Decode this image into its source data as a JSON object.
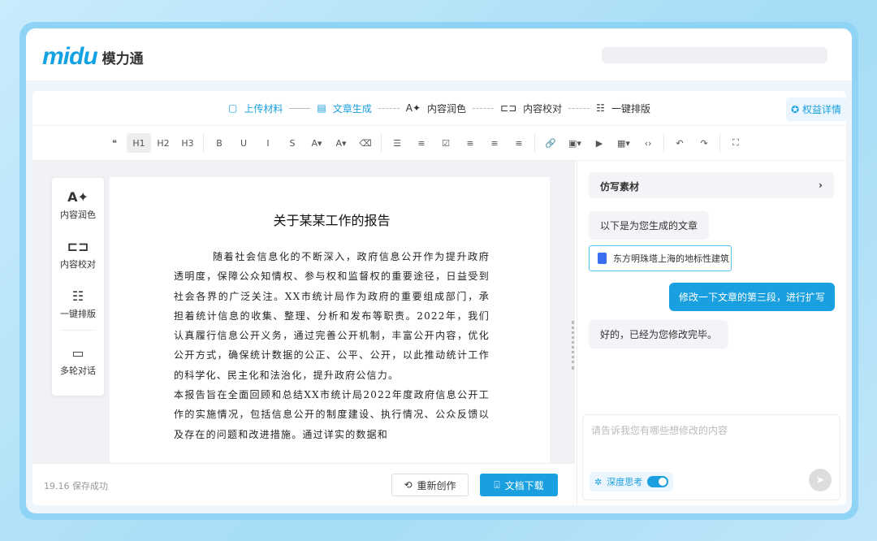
{
  "brand": {
    "logo_text": "midu",
    "name": "模力通"
  },
  "steps": [
    {
      "label": "上传材料",
      "icon": "folder-icon"
    },
    {
      "label": "文章生成",
      "icon": "document-icon"
    },
    {
      "label": "内容润色",
      "icon": "font-sparkle-icon"
    },
    {
      "label": "内容校对",
      "icon": "proofread-icon"
    },
    {
      "label": "一键排版",
      "icon": "layout-icon"
    }
  ],
  "rights_label": "权益详情",
  "toolbar": [
    "❝",
    "H1",
    "H2",
    "H3",
    "B",
    "U",
    "I",
    "S",
    "A▾",
    "A▾",
    "⌫",
    "☰",
    "≡",
    "☑",
    "≡",
    "≡",
    "≡",
    "🔗",
    "▣▾",
    "▶",
    "▦▾",
    "‹›",
    "↶",
    "↷",
    "⛶"
  ],
  "side_tools": [
    {
      "label": "内容润色",
      "icon": "A✦"
    },
    {
      "label": "内容校对",
      "icon": "⊏⊐"
    },
    {
      "label": "一键排版",
      "icon": "☷"
    },
    {
      "label": "多轮对话",
      "icon": "▭"
    }
  ],
  "doc": {
    "title": "关于某某工作的报告",
    "paragraphs": [
      "随着社会信息化的不断深入，政府信息公开作为提升政府透明度，保障公众知情权、参与权和监督权的重要途径，日益受到社会各界的广泛关注。XX市统计局作为政府的重要组成部门，承担着统计信息的收集、整理、分析和发布等职责。2022年，我们认真履行信息公开义务，通过完善公开机制，丰富公开内容，优化公开方式，确保统计数据的公正、公平、公开，以此推动统计工作的科学化、民主化和法治化，提升政府公信力。",
      "本报告旨在全面回顾和总结XX市统计局2022年度政府信息公开工作的实施情况，包括信息公开的制度建设、执行情况、公众反馈以及存在的问题和改进措施。通过详实的数据和"
    ]
  },
  "footer": {
    "status": "19.16 保存成功",
    "regen": "重新创作",
    "download": "文档下载"
  },
  "chat": {
    "material": "仿写素材",
    "msg1": "以下是为您生成的文章",
    "file": "东方明珠塔上海的地标性建筑",
    "user": "修改一下文章的第三段，进行扩写",
    "reply": "好的，已经为您修改完毕。",
    "placeholder": "请告诉我您有哪些想修改的内容",
    "deep": "深度思考"
  }
}
